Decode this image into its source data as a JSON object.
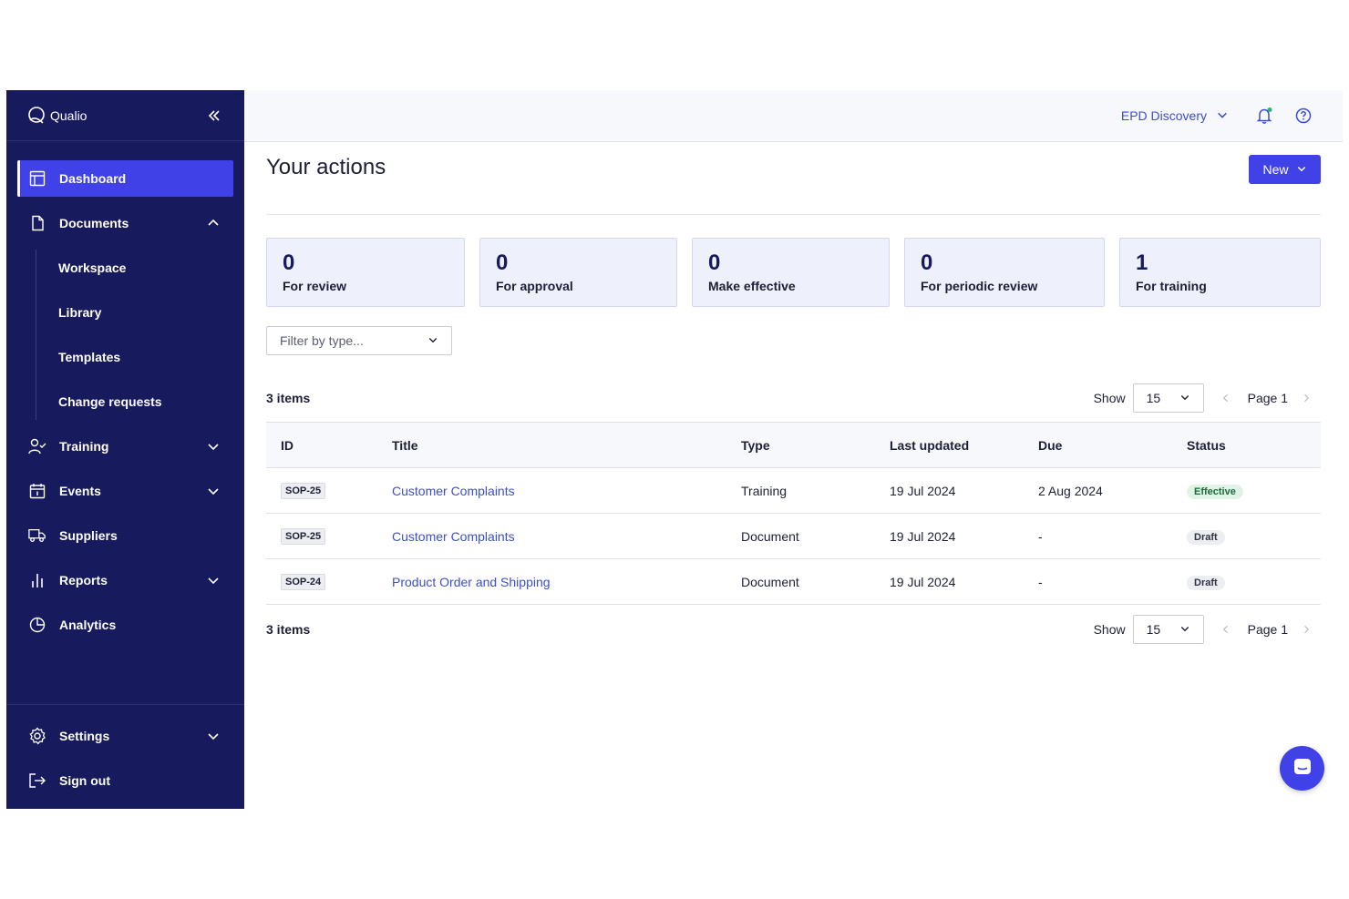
{
  "brand": {
    "name": "Qualio"
  },
  "sidebar": {
    "items": [
      {
        "label": "Dashboard"
      },
      {
        "label": "Documents"
      },
      {
        "label": "Training"
      },
      {
        "label": "Events"
      },
      {
        "label": "Suppliers"
      },
      {
        "label": "Reports"
      },
      {
        "label": "Analytics"
      }
    ],
    "documents_sub": [
      {
        "label": "Workspace"
      },
      {
        "label": "Library"
      },
      {
        "label": "Templates"
      },
      {
        "label": "Change requests"
      }
    ],
    "bottom": [
      {
        "label": "Settings"
      },
      {
        "label": "Sign out"
      }
    ]
  },
  "topbar": {
    "workspace": "EPD Discovery"
  },
  "page": {
    "title": "Your actions",
    "new_label": "New"
  },
  "cards": [
    {
      "count": "0",
      "label": "For review"
    },
    {
      "count": "0",
      "label": "For approval"
    },
    {
      "count": "0",
      "label": "Make effective"
    },
    {
      "count": "0",
      "label": "For periodic review"
    },
    {
      "count": "1",
      "label": "For training"
    }
  ],
  "filter": {
    "placeholder": "Filter by type..."
  },
  "list": {
    "count_label": "3 items",
    "show_label": "Show",
    "page_size": "15",
    "page_label": "Page 1"
  },
  "table": {
    "headers": {
      "id": "ID",
      "title": "Title",
      "type": "Type",
      "updated": "Last updated",
      "due": "Due",
      "status": "Status"
    },
    "rows": [
      {
        "id": "SOP-25",
        "title": "Customer Complaints",
        "type": "Training",
        "updated": "19 Jul 2024",
        "due": "2 Aug 2024",
        "status": "Effective"
      },
      {
        "id": "SOP-25",
        "title": "Customer Complaints",
        "type": "Document",
        "updated": "19 Jul 2024",
        "due": "-",
        "status": "Draft"
      },
      {
        "id": "SOP-24",
        "title": "Product Order and Shipping",
        "type": "Document",
        "updated": "19 Jul 2024",
        "due": "-",
        "status": "Draft"
      }
    ]
  },
  "colors": {
    "sidebar_bg": "#171a5c",
    "accent": "#4042e8",
    "link": "#3b4ed1"
  }
}
